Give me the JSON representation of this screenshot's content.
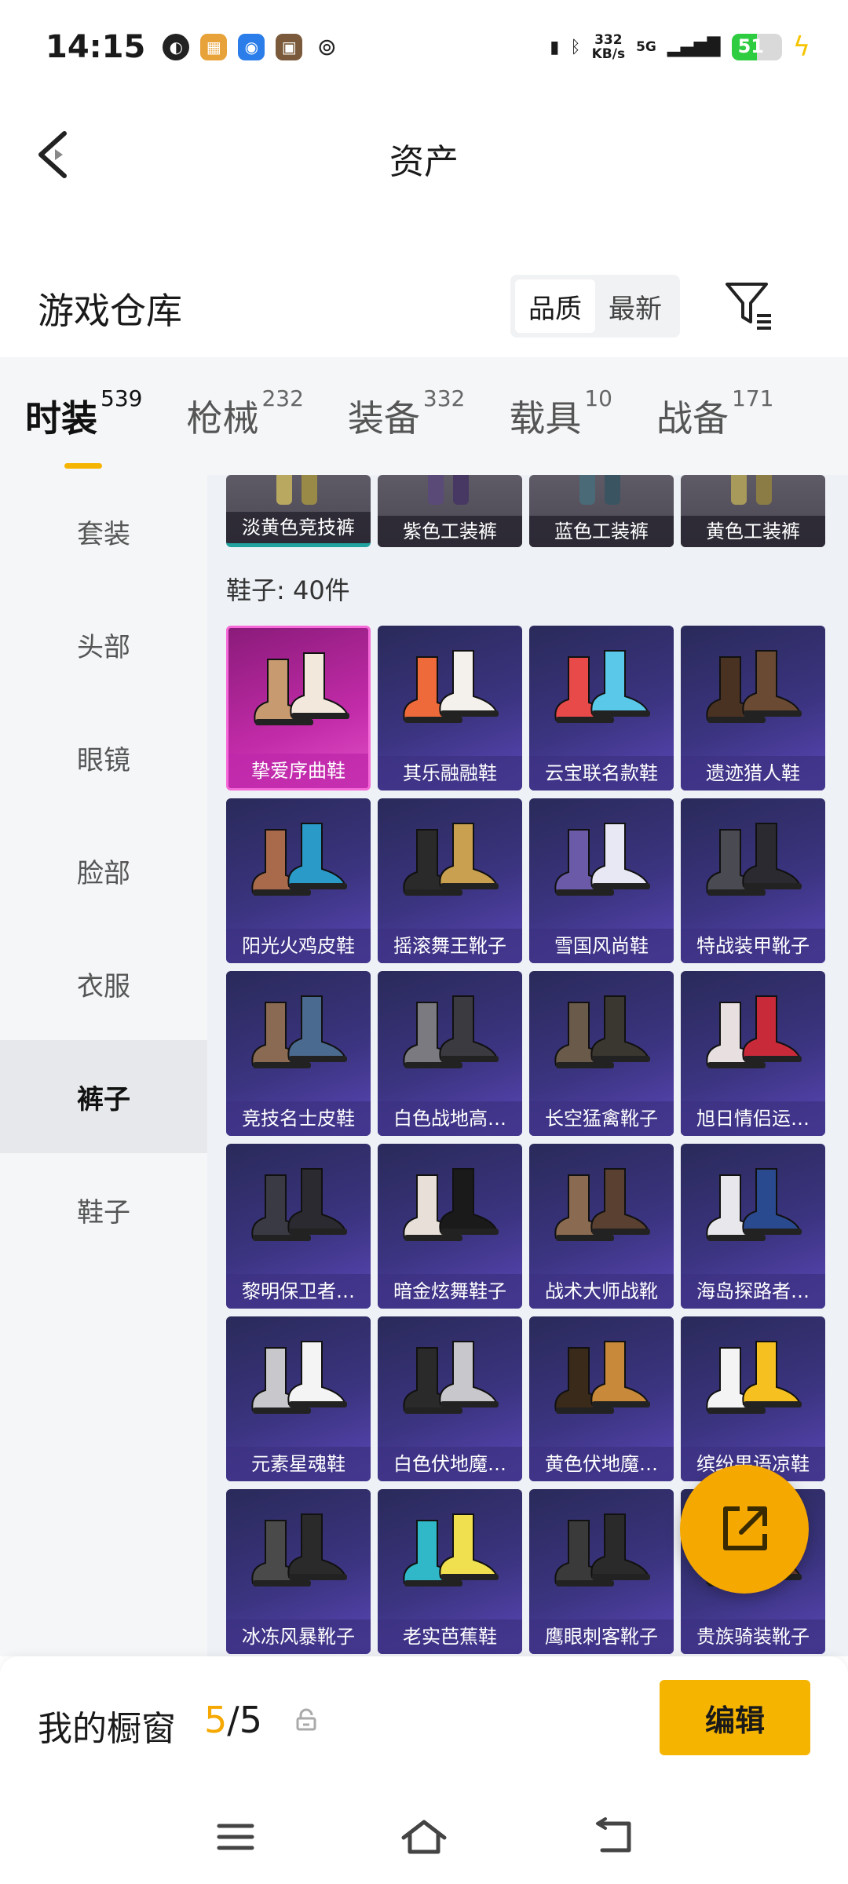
{
  "status_bar": {
    "time": "14:15",
    "speed_value": "332",
    "speed_unit": "KB/s",
    "network": "5G",
    "battery": "51",
    "battery_level": 0.51
  },
  "header": {
    "title": "资产"
  },
  "warehouse": {
    "title": "游戏仓库",
    "sort_options": [
      "品质",
      "最新"
    ]
  },
  "tabs": [
    {
      "label": "时装",
      "count": "539",
      "active": true
    },
    {
      "label": "枪械",
      "count": "232"
    },
    {
      "label": "装备",
      "count": "332"
    },
    {
      "label": "载具",
      "count": "10"
    },
    {
      "label": "战备",
      "count": "171"
    }
  ],
  "sidebar": {
    "items": [
      "套装",
      "头部",
      "眼镜",
      "脸部",
      "衣服",
      "裤子",
      "鞋子"
    ],
    "active": "裤子"
  },
  "pants_row": [
    "淡黄色竞技裤",
    "紫色工装裤",
    "蓝色工装裤",
    "黄色工装裤"
  ],
  "section": {
    "label": "鞋子: 40件"
  },
  "items": [
    "挚爱序曲鞋",
    "其乐融融鞋",
    "云宝联名款鞋",
    "遗迹猎人鞋",
    "阳光火鸡皮鞋",
    "摇滚舞王靴子",
    "雪国风尚鞋",
    "特战装甲靴子",
    "竞技名士皮鞋",
    "白色战地高…",
    "长空猛禽靴子",
    "旭日情侣运…",
    "黎明保卫者…",
    "暗金炫舞鞋子",
    "战术大师战靴",
    "海岛探路者…",
    "元素星魂鞋",
    "白色伏地魔…",
    "黄色伏地魔…",
    "缤纷果语凉鞋",
    "冰冻风暴靴子",
    "老实芭蕉鞋",
    "鹰眼刺客靴子",
    "贵族骑装靴子"
  ],
  "showcase": {
    "label": "我的橱窗",
    "current": "5",
    "separator": "/",
    "total": "5",
    "edit_label": "编辑"
  },
  "colors": {
    "accent": "#f5b400",
    "card_purple": "#3b3480",
    "card_pink": "#c22ba8"
  }
}
